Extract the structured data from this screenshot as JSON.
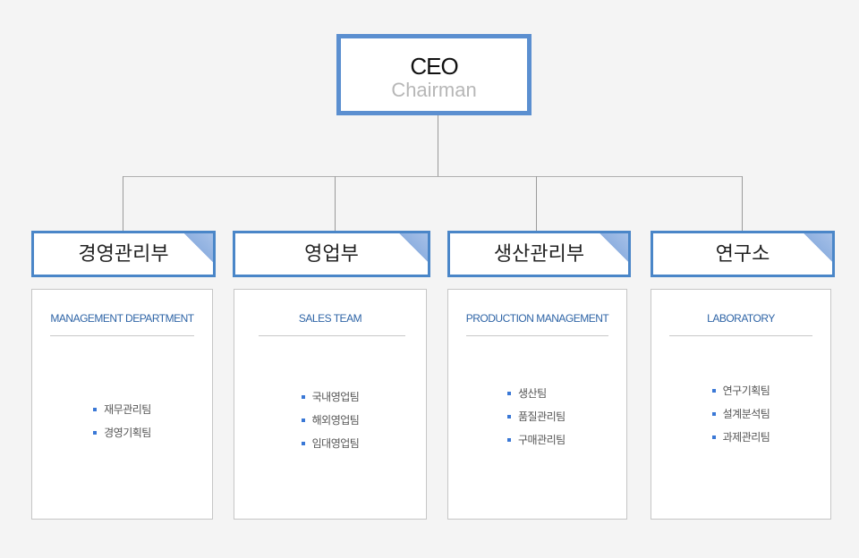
{
  "ceo": {
    "title": "CEO",
    "subtitle": "Chairman"
  },
  "colors": {
    "accent": "#4a86c8",
    "corner": "#9ebae4",
    "english_label": "#2e64a6",
    "bullet": "#3a78d6",
    "background": "#f4f4f4"
  },
  "departments": [
    {
      "name": "경영관리부",
      "english": "MANAGEMENT DEPARTMENT",
      "teams": [
        "재무관리팀",
        "경영기획팀"
      ]
    },
    {
      "name": "영업부",
      "english": "SALES TEAM",
      "teams": [
        "국내영업팀",
        "해외영업팀",
        "임대영업팀"
      ]
    },
    {
      "name": "생산관리부",
      "english": "PRODUCTION MANAGEMENT",
      "teams": [
        "생산팀",
        "품질관리팀",
        "구매관리팀"
      ]
    },
    {
      "name": "연구소",
      "english": "LABORATORY",
      "teams": [
        "연구기획팀",
        "설계분석팀",
        "과제관리팀"
      ]
    }
  ]
}
